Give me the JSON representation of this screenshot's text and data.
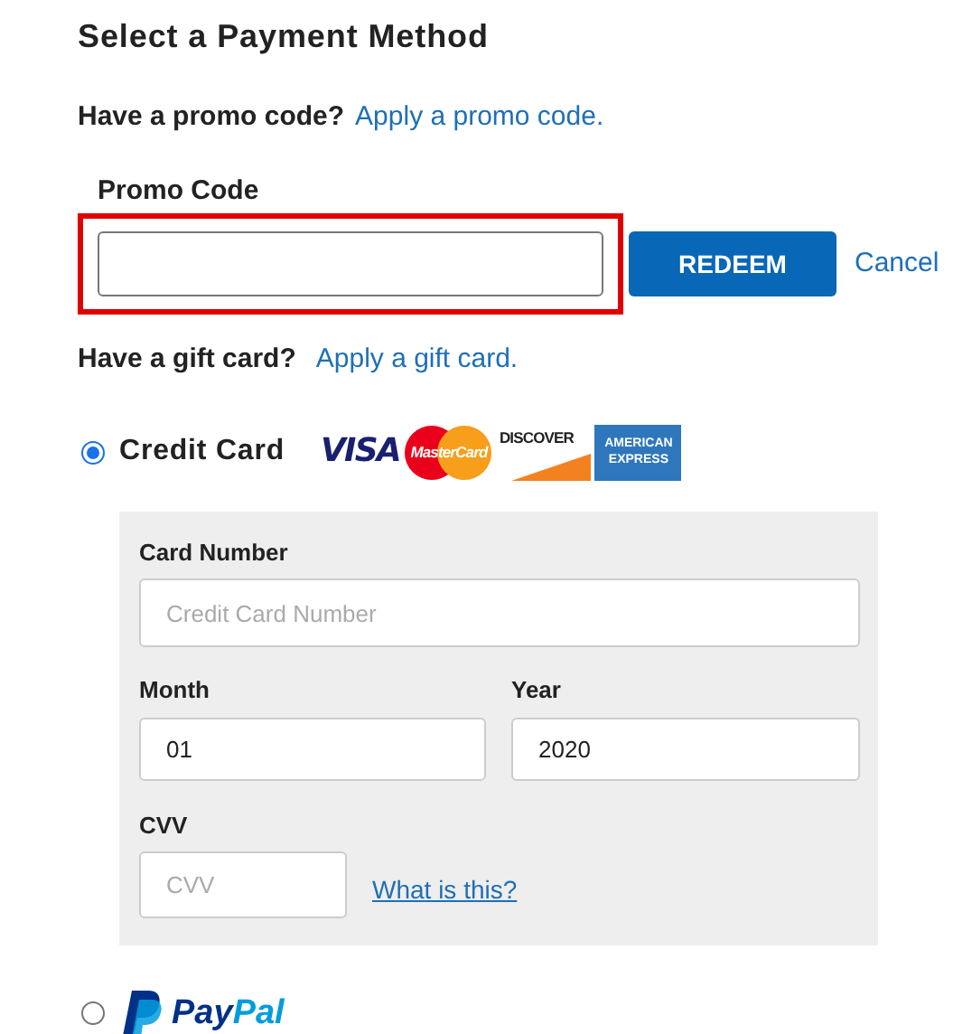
{
  "title": "Select a Payment Method",
  "promo": {
    "question": "Have a promo code?",
    "link": "Apply a promo code.",
    "label": "Promo Code",
    "highlighted": true,
    "button": "REDEEM",
    "cancel": "Cancel"
  },
  "gift": {
    "question": "Have a gift card?",
    "link": "Apply a gift card."
  },
  "methods": [
    {
      "kind": "card",
      "label": "Credit Card",
      "selected": true,
      "logos": [
        {
          "kind": "visa",
          "text": "VISA"
        },
        {
          "kind": "mastercard",
          "text": "MasterCard"
        },
        {
          "kind": "discover",
          "text": "DISCOVER"
        },
        {
          "kind": "amex",
          "text": "AMERICAN EXPRESS"
        }
      ],
      "form": {
        "card_number": {
          "label": "Card Number",
          "placeholder": "Credit Card Number"
        },
        "month": {
          "label": "Month",
          "value": "01"
        },
        "year": {
          "label": "Year",
          "value": "2020"
        },
        "cvv": {
          "label": "CVV",
          "placeholder": "CVV"
        },
        "help_link": "What is this?"
      }
    },
    {
      "kind": "paypal",
      "selected": false,
      "logo": {
        "part_1": "Pay",
        "part_2": "Pal"
      }
    }
  ]
}
